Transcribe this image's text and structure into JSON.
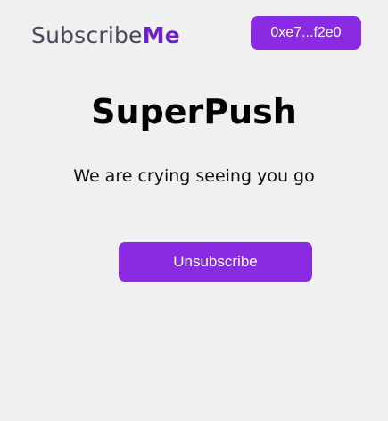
{
  "header": {
    "logo_part1": "Subscribe",
    "logo_part2": "Me",
    "wallet_address": "0xe7...f2e0"
  },
  "main": {
    "title": "SuperPush",
    "message": "We are crying seeing you go",
    "unsubscribe_label": "Unsubscribe"
  },
  "colors": {
    "accent": "#8a2be2",
    "logo_dark": "#4b465a",
    "logo_purple": "#6b22c4",
    "background": "#f1f0f1"
  }
}
